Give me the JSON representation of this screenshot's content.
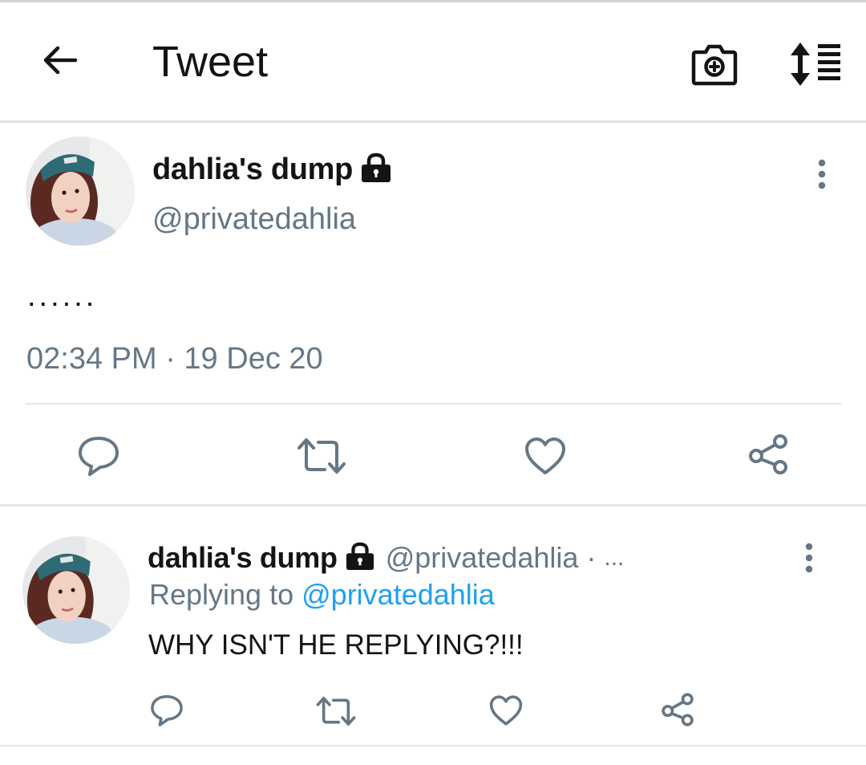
{
  "header": {
    "title": "Tweet",
    "back_icon": "arrow-left-icon",
    "camera_icon": "camera-add-icon",
    "sort_icon": "sort-list-icon"
  },
  "main_tweet": {
    "display_name": "dahlia's dump",
    "handle": "@privatedahlia",
    "text": "......",
    "timestamp": "02:34 PM · 19 Dec 20",
    "protected_icon": "lock-icon",
    "actions": [
      "reply-icon",
      "retweet-icon",
      "like-icon",
      "share-icon"
    ]
  },
  "reply_tweet": {
    "display_name": "dahlia's dump",
    "handle": "@privatedahlia",
    "separator": "·",
    "ellipsis": "...",
    "replying_label": "Replying to",
    "replying_handle": "@privatedahlia",
    "text": "WHY ISN'T HE REPLYING?!!!",
    "actions": [
      "reply-icon",
      "retweet-icon",
      "like-icon",
      "share-icon"
    ]
  },
  "colors": {
    "text_primary": "#141414",
    "text_secondary": "#657786",
    "link": "#1da1f2",
    "divider": "#e3e7ea"
  }
}
